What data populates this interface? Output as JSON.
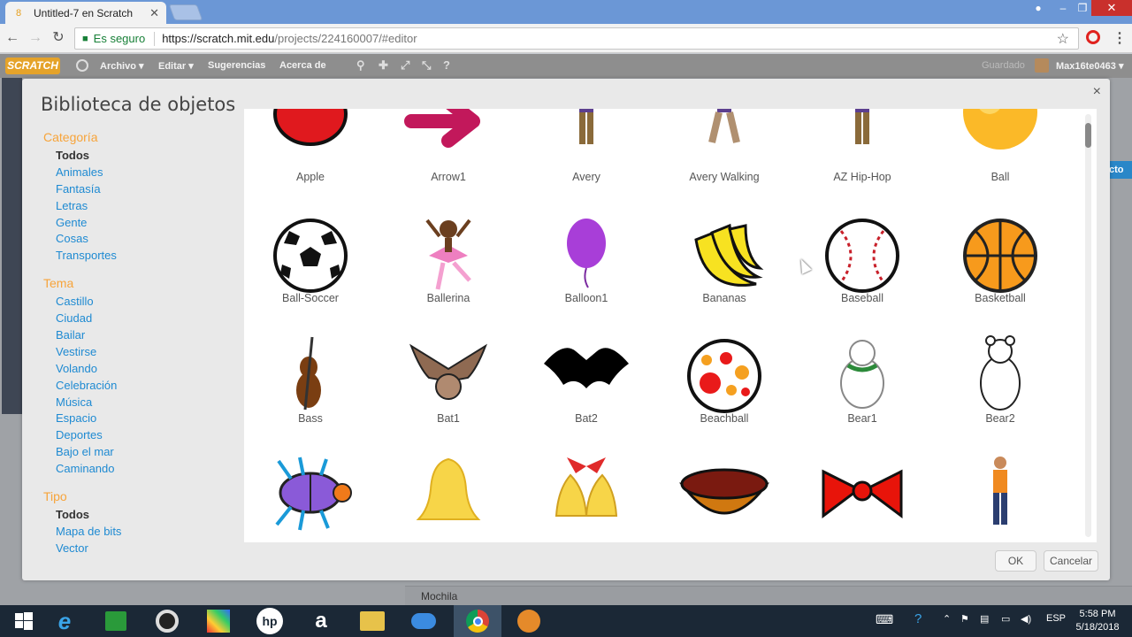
{
  "browser": {
    "tab_title": "Untitled-7 en Scratch",
    "secure_label": "Es seguro",
    "url_host": "https://scratch.mit.edu",
    "url_path": "/projects/224160007/#editor"
  },
  "scratch_menu": {
    "items": [
      "Archivo ▾",
      "Editar ▾",
      "Sugerencias",
      "Acerca de"
    ],
    "saved_status": "Guardado",
    "username": "Max16te0463 ▾",
    "backdrop_label": "Mochila",
    "right_button": "cto"
  },
  "dialog": {
    "title": "Biblioteca de objetos",
    "close": "×",
    "ok_label": "OK",
    "cancel_label": "Cancelar",
    "categoria": {
      "heading": "Categoría",
      "items": [
        "Todos",
        "Animales",
        "Fantasía",
        "Letras",
        "Gente",
        "Cosas",
        "Transportes"
      ]
    },
    "tema": {
      "heading": "Tema",
      "items": [
        "Castillo",
        "Ciudad",
        "Bailar",
        "Vestirse",
        "Volando",
        "Celebración",
        "Música",
        "Espacio",
        "Deportes",
        "Bajo el mar",
        "Caminando"
      ]
    },
    "tipo": {
      "heading": "Tipo",
      "items": [
        "Todos",
        "Mapa de bits",
        "Vector"
      ]
    },
    "sprites": [
      {
        "name": "Apple",
        "icon": "apple-icon"
      },
      {
        "name": "Arrow1",
        "icon": "arrow-icon"
      },
      {
        "name": "Avery",
        "icon": "person-icon"
      },
      {
        "name": "Avery Walking",
        "icon": "person-walking-icon"
      },
      {
        "name": "AZ Hip-Hop",
        "icon": "person-icon"
      },
      {
        "name": "Ball",
        "icon": "ball-icon"
      },
      {
        "name": "Ball-Soccer",
        "icon": "soccer-ball-icon"
      },
      {
        "name": "Ballerina",
        "icon": "ballerina-icon"
      },
      {
        "name": "Balloon1",
        "icon": "balloon-icon"
      },
      {
        "name": "Bananas",
        "icon": "bananas-icon"
      },
      {
        "name": "Baseball",
        "icon": "baseball-icon"
      },
      {
        "name": "Basketball",
        "icon": "basketball-icon"
      },
      {
        "name": "Bass",
        "icon": "bass-icon"
      },
      {
        "name": "Bat1",
        "icon": "bat-icon"
      },
      {
        "name": "Bat2",
        "icon": "bat-silhouette-icon"
      },
      {
        "name": "Beachball",
        "icon": "beachball-icon"
      },
      {
        "name": "Bear1",
        "icon": "bear-icon"
      },
      {
        "name": "Bear2",
        "icon": "bear-outline-icon"
      },
      {
        "name": "",
        "icon": "beetle-icon"
      },
      {
        "name": "",
        "icon": "bell-icon"
      },
      {
        "name": "",
        "icon": "bells-icon"
      },
      {
        "name": "",
        "icon": "bowl-icon"
      },
      {
        "name": "",
        "icon": "bowtie-icon"
      },
      {
        "name": "",
        "icon": "boy-icon"
      }
    ]
  },
  "taskbar": {
    "language": "ESP",
    "time": "5:58 PM",
    "date": "5/18/2018"
  }
}
